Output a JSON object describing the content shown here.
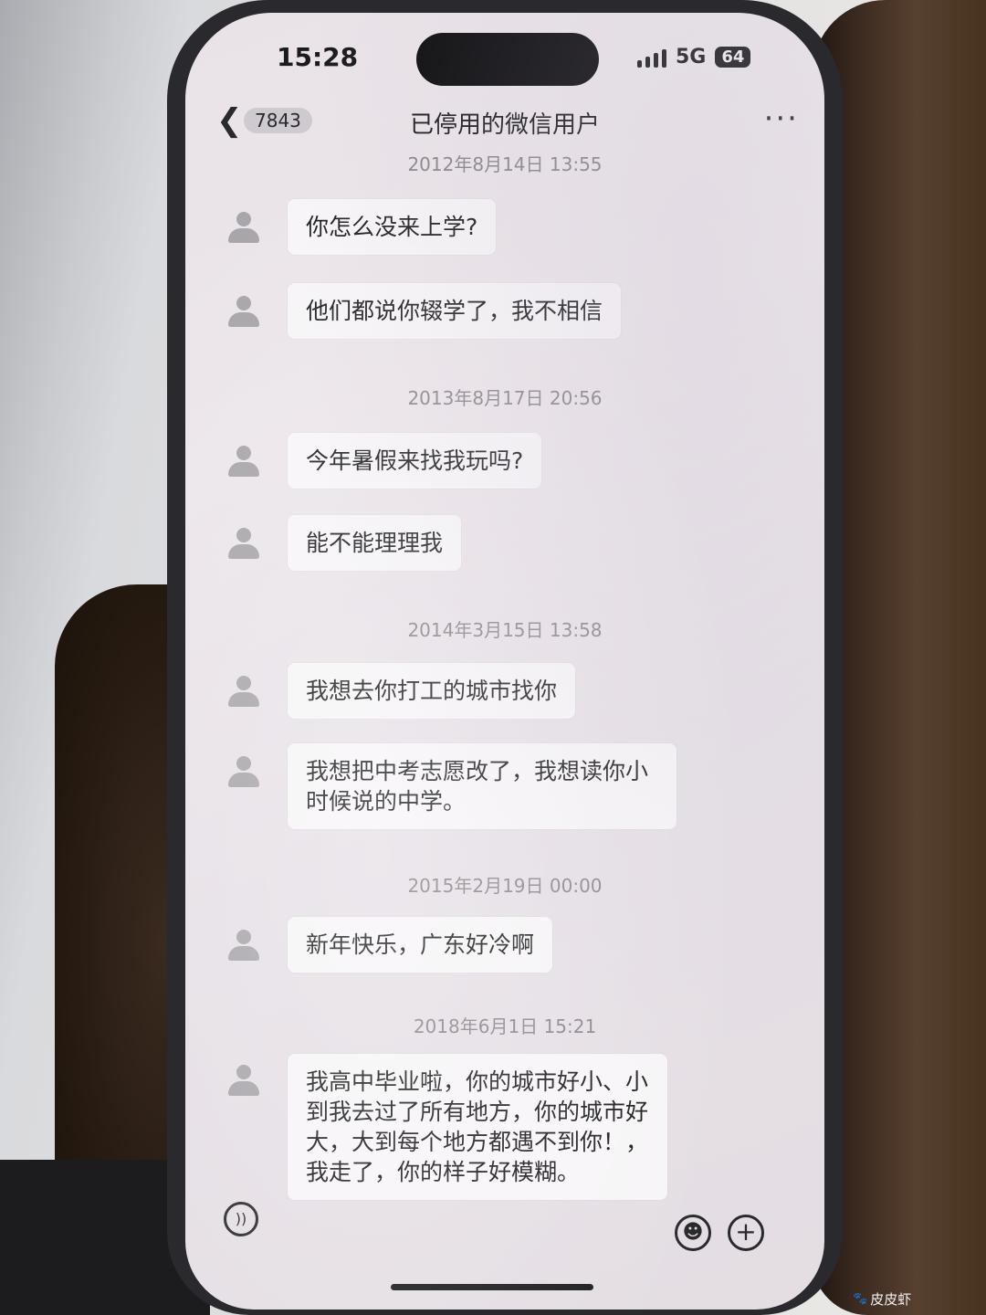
{
  "status_bar": {
    "time": "15:28",
    "network": "5G",
    "battery": "64"
  },
  "nav": {
    "back_badge": "7843",
    "title": "已停用的微信用户",
    "more": "···"
  },
  "chat": {
    "groups": [
      {
        "timestamp": "2012年8月14日 13:55",
        "messages": [
          "你怎么没来上学?",
          "他们都说你辍学了，我不相信"
        ]
      },
      {
        "timestamp": "2013年8月17日 20:56",
        "messages": [
          "今年暑假来找我玩吗?",
          "能不能理理我"
        ]
      },
      {
        "timestamp": "2014年3月15日 13:58",
        "messages": [
          "我想去你打工的城市找你",
          "我想把中考志愿改了，我想读你小时候说的中学。"
        ]
      },
      {
        "timestamp": "2015年2月19日 00:00",
        "messages": [
          "新年快乐，广东好冷啊"
        ]
      },
      {
        "timestamp": "2018年6月1日 15:21",
        "messages": [
          "我高中毕业啦，你的城市好小、小到我去过了所有地方，你的城市好大，大到每个地方都遇不到你！，我走了，你的样子好模糊。"
        ]
      }
    ]
  },
  "input_bar": {
    "voice_icon": "voice-icon",
    "emoji_icon": "emoji-icon",
    "plus_icon": "plus-icon"
  },
  "watermark": {
    "text": "皮皮虾"
  }
}
